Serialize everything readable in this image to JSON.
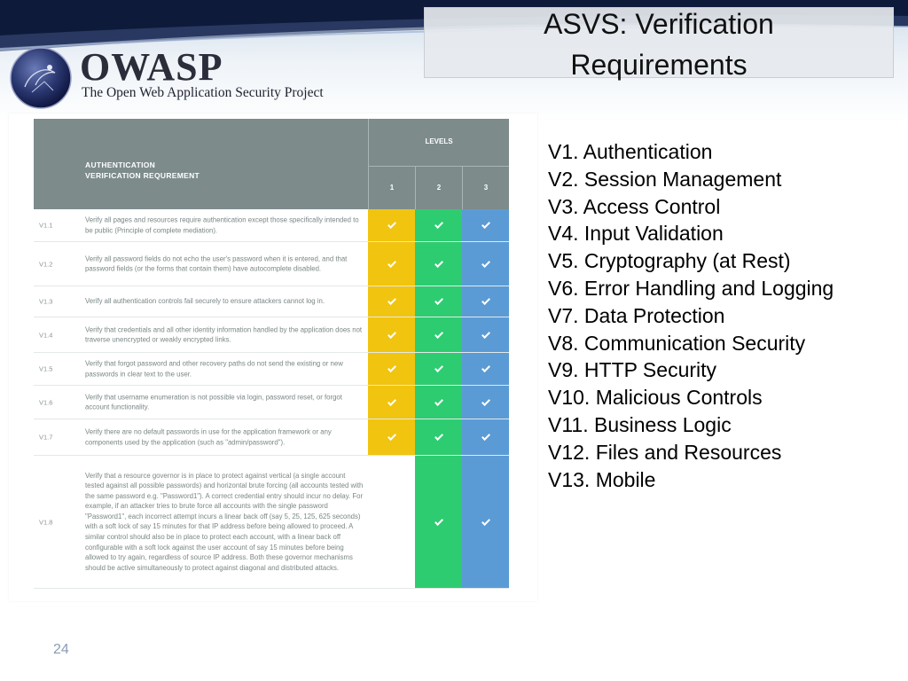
{
  "header": {
    "logo_word": "OWASP",
    "logo_tagline": "The Open Web Application Security Project",
    "title_line1": "ASVS: Verification",
    "title_line2": "Requirements"
  },
  "colors": {
    "level1": "#f1c40f",
    "level2": "#2ecc71",
    "level3": "#5b9bd5",
    "header_bg": "#7d8b8b"
  },
  "table": {
    "head_title_line1": "AUTHENTICATION",
    "head_title_line2": "VERIFICATION REQUREMENT",
    "levels_label": "LEVELS",
    "level_cols": [
      "1",
      "2",
      "3"
    ],
    "rows": [
      {
        "id": "V1.1",
        "text": "Verify all pages and resources require authentication except those specifically intended to be public (Principle of complete mediation).",
        "levels": [
          true,
          true,
          true
        ]
      },
      {
        "id": "V1.2",
        "text": "Verify all password fields do not echo the user's password when it is entered, and that password fields (or the forms that contain them) have autocomplete disabled.",
        "levels": [
          true,
          true,
          true
        ]
      },
      {
        "id": "V1.3",
        "text": "Verify all authentication controls fail securely to ensure attackers cannot log in.",
        "levels": [
          true,
          true,
          true
        ]
      },
      {
        "id": "V1.4",
        "text": "Verify that credentials and all other identity information handled by the application does not traverse unencrypted or weakly encrypted links.",
        "levels": [
          true,
          true,
          true
        ]
      },
      {
        "id": "V1.5",
        "text": "Verify that forgot password and other recovery paths do not send the existing or new passwords in clear text to the user.",
        "levels": [
          true,
          true,
          true
        ]
      },
      {
        "id": "V1.6",
        "text": "Verify that username enumeration is not possible via login, password reset, or forgot account functionality.",
        "levels": [
          true,
          true,
          true
        ]
      },
      {
        "id": "V1.7",
        "text": "Verify there are no default passwords in use for the application framework or any components used by the application (such as \"admin/password\").",
        "levels": [
          true,
          true,
          true
        ]
      },
      {
        "id": "V1.8",
        "text": "Verify that a resource governor is in place to protect against vertical (a single account tested against all possible passwords) and horizontal brute forcing (all accounts tested with the same password e.g. \"Password1\"). A correct credential entry should incur no delay. For example, if an attacker tries to brute force all accounts with the single password \"Password1\", each incorrect attempt incurs a linear back off (say 5, 25, 125, 625 seconds) with a soft lock of say 15 minutes for that IP address before being allowed to proceed. A similar control should also be in place to protect each account, with a linear back off configurable with a soft lock against the user account of say 15 minutes before being allowed to try again, regardless of source IP address. Both these governor mechanisms should be active simultaneously to protect against diagonal and distributed attacks.",
        "levels": [
          false,
          true,
          true
        ]
      }
    ]
  },
  "verification_list": [
    "V1.  Authentication",
    "V2.  Session Management",
    "V3.  Access Control",
    "V4.  Input Validation",
    "V5.  Cryptography (at Rest)",
    "V6.  Error Handling and Logging",
    "V7.  Data Protection",
    "V8.  Communication Security",
    "V9.  HTTP Security",
    "V10.  Malicious Controls",
    "V11.  Business Logic",
    "V12.  Files and Resources",
    "V13.  Mobile"
  ],
  "page_number": "24"
}
